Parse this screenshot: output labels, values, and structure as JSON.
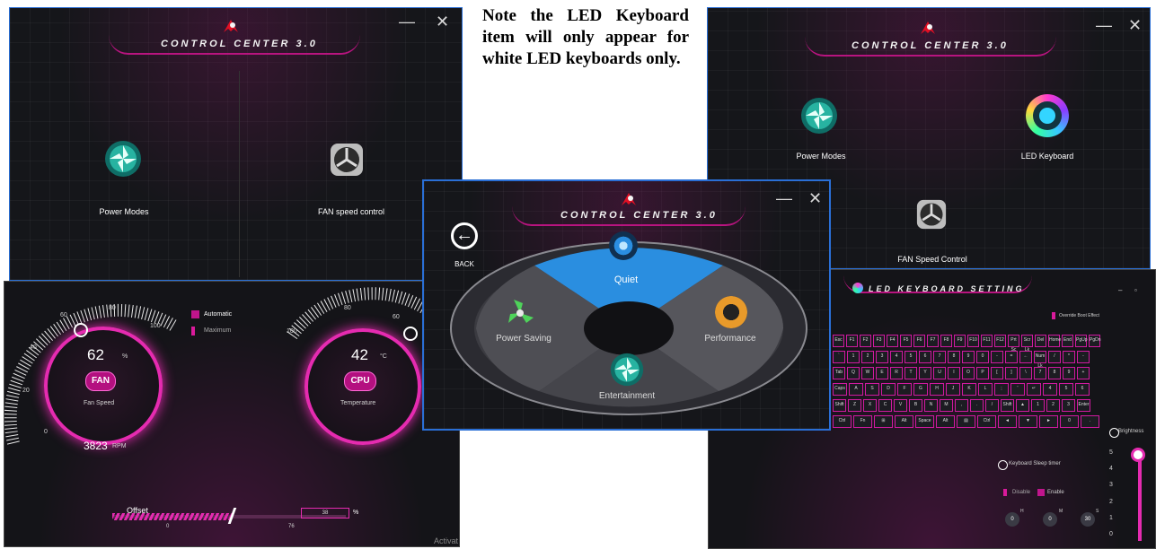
{
  "note": {
    "text": "Note the LED Keyboard item will only appear for white LED keyboards only."
  },
  "window_left": {
    "title": "CONTROL CENTER 3.0",
    "minimize": "—",
    "close": "✕",
    "items": [
      "Power Modes",
      "FAN speed control"
    ]
  },
  "window_right": {
    "title": "CONTROL CENTER 3.0",
    "minimize": "—",
    "close": "✕",
    "items": [
      "Power Modes",
      "LED Keyboard",
      "FAN Speed Control"
    ]
  },
  "window_center": {
    "title": "CONTROL CENTER 3.0",
    "minimize": "—",
    "close": "✕",
    "back_label": "BACK",
    "modes": {
      "quiet": "Quiet",
      "power_saving": "Power Saving",
      "performance": "Performance",
      "entertainment": "Entertainment"
    },
    "colors": {
      "quiet_active": "#2a8ee0"
    }
  },
  "fan_panel": {
    "fan_gauge": {
      "ticks": [
        "0",
        "20",
        "40",
        "60",
        "80",
        "100"
      ],
      "value": "62",
      "unit": "%",
      "badge": "FAN",
      "caption": "Fan Speed",
      "rpm_value": "3823",
      "rpm_unit": "RPM"
    },
    "cpu_gauge": {
      "ticks": [
        "100",
        "80",
        "60"
      ],
      "value": "42",
      "unit": "°C",
      "badge": "CPU",
      "caption": "Temperature"
    },
    "options": {
      "automatic": "Automatic",
      "maximum": "Maximum"
    },
    "offset": {
      "label": "Offset",
      "min_label": "0",
      "max_label": "76",
      "value": "38",
      "unit": "%"
    },
    "watermark": "Activat"
  },
  "led_panel": {
    "title": "LED KEYBOARD SETTING",
    "override": "Override Boot Effect",
    "brightness_label": "Brightness",
    "brightness_scale": [
      "5",
      "4",
      "3",
      "2",
      "1",
      "0"
    ],
    "brightness_level": 5,
    "sleep_timer": {
      "label": "Keyboard Sleep timer",
      "disable": "Disable",
      "enable": "Enable",
      "h_label": "H",
      "m_label": "M",
      "s_label": "S",
      "hours": "0",
      "minutes": "0",
      "seconds": "30"
    },
    "key_rows": [
      [
        "Esc",
        "F1",
        "F2",
        "F3",
        "F4",
        "F5",
        "F6",
        "F7",
        "F8",
        "F9",
        "F10",
        "F11",
        "F12",
        "Prt Sc",
        "Scr Lk",
        "Del",
        "Home",
        "End",
        "PgUp",
        "PgDn"
      ],
      [
        "`",
        "1",
        "2",
        "3",
        "4",
        "5",
        "6",
        "7",
        "8",
        "9",
        "0",
        "-",
        "=",
        "←",
        "Num Lk",
        "/",
        "*",
        "-"
      ],
      [
        "Tab",
        "Q",
        "W",
        "E",
        "R",
        "T",
        "Y",
        "U",
        "I",
        "O",
        "P",
        "[",
        "]",
        "\\",
        "7",
        "8",
        "9",
        "+"
      ],
      [
        "Caps",
        "A",
        "S",
        "D",
        "F",
        "G",
        "H",
        "J",
        "K",
        "L",
        ";",
        "'",
        "↵",
        "4",
        "5",
        "6"
      ],
      [
        "Shift",
        "Z",
        "X",
        "C",
        "V",
        "B",
        "N",
        "M",
        ",",
        ".",
        "/",
        "Shift",
        "▲",
        "1",
        "2",
        "3",
        "Enter"
      ],
      [
        "Ctrl",
        "Fn",
        "⊞",
        "Alt",
        "Space",
        "Alt",
        "▤",
        "Ctrl",
        "◄",
        "▼",
        "►",
        "0",
        "."
      ]
    ]
  }
}
